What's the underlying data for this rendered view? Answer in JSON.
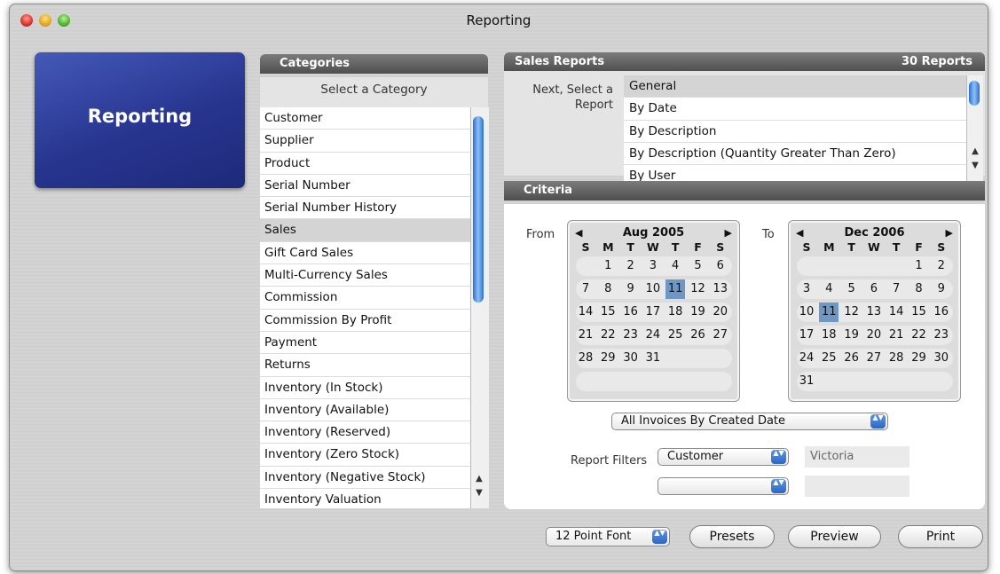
{
  "window": {
    "title": "Reporting"
  },
  "logo": {
    "label": "Reporting"
  },
  "categories": {
    "header": "Categories",
    "subtitle": "Select a Category",
    "selected": "Sales",
    "items": [
      "Customer",
      "Supplier",
      "Product",
      "Serial Number",
      "Serial Number History",
      "Sales",
      "Gift Card Sales",
      "Multi-Currency Sales",
      "Commission",
      "Commission By Profit",
      "Payment",
      "Returns",
      "Inventory (In Stock)",
      "Inventory (Available)",
      "Inventory (Reserved)",
      "Inventory (Zero Stock)",
      "Inventory (Negative Stock)",
      "Inventory Valuation"
    ]
  },
  "reports": {
    "header": "Sales Reports",
    "count": "30 Reports",
    "prompt": "Next, Select a Report",
    "selected": "General",
    "items": [
      "General",
      "By Date",
      "By Description",
      "By Description (Quantity Greater Than Zero)",
      "By User"
    ]
  },
  "criteria": {
    "header": "Criteria",
    "from_label": "From",
    "to_label": "To",
    "from_calendar": {
      "month": "Aug 2005",
      "days_of_week": [
        "S",
        "M",
        "T",
        "W",
        "T",
        "F",
        "S"
      ],
      "selected_day": "11",
      "weeks": [
        [
          "",
          "1",
          "2",
          "3",
          "4",
          "5",
          "6"
        ],
        [
          "7",
          "8",
          "9",
          "10",
          "11",
          "12",
          "13"
        ],
        [
          "14",
          "15",
          "16",
          "17",
          "18",
          "19",
          "20"
        ],
        [
          "21",
          "22",
          "23",
          "24",
          "25",
          "26",
          "27"
        ],
        [
          "28",
          "29",
          "30",
          "31",
          "",
          "",
          ""
        ],
        [
          "",
          "",
          "",
          "",
          "",
          "",
          ""
        ]
      ]
    },
    "to_calendar": {
      "month": "Dec 2006",
      "days_of_week": [
        "S",
        "M",
        "T",
        "W",
        "T",
        "F",
        "S"
      ],
      "selected_day": "11",
      "weeks": [
        [
          "",
          "",
          "",
          "",
          "",
          "1",
          "2"
        ],
        [
          "3",
          "4",
          "5",
          "6",
          "7",
          "8",
          "9"
        ],
        [
          "10",
          "11",
          "12",
          "13",
          "14",
          "15",
          "16"
        ],
        [
          "17",
          "18",
          "19",
          "20",
          "21",
          "22",
          "23"
        ],
        [
          "24",
          "25",
          "26",
          "27",
          "28",
          "29",
          "30"
        ],
        [
          "31",
          "",
          "",
          "",
          "",
          "",
          ""
        ]
      ]
    },
    "date_mode": "All Invoices By Created Date",
    "filters_label": "Report Filters",
    "filter1": {
      "field": "Customer",
      "value": "Victoria"
    },
    "filter2": {
      "field": "",
      "value": ""
    }
  },
  "footer": {
    "font_size": "12 Point Font",
    "presets": "Presets",
    "preview": "Preview",
    "print": "Print"
  },
  "icons": {
    "prev_month": "◀",
    "next_month": "▶",
    "scroll_up": "▲",
    "scroll_down": "▼",
    "stepper": "▲▼"
  }
}
